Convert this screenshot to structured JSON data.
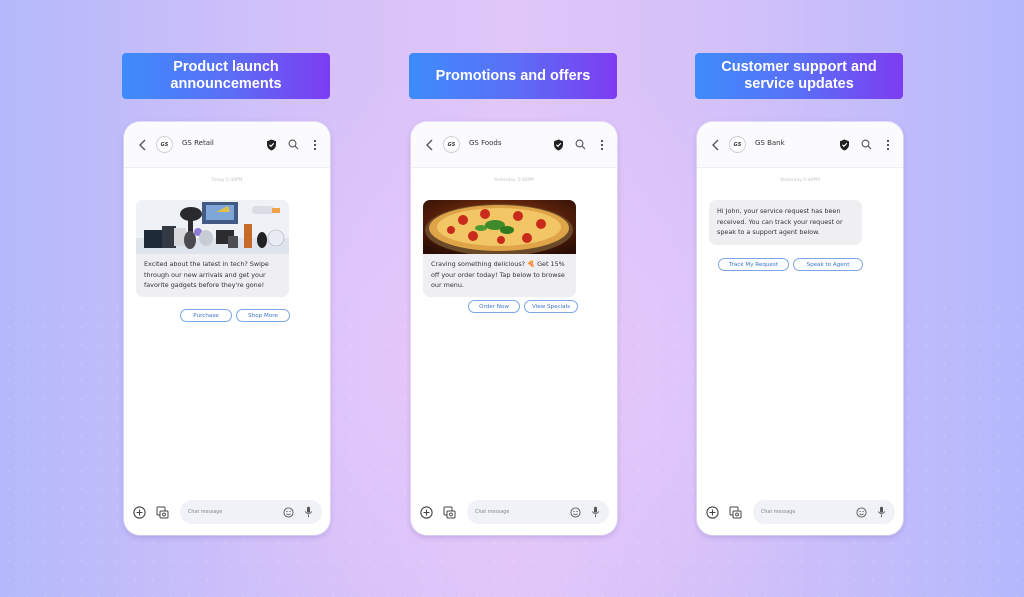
{
  "theme": {
    "accent_chip_border": "#7aa6e8",
    "accent_chip_text": "#3e73c9",
    "badge_gradient": [
      "#3e8cfc",
      "#7d3cf1"
    ]
  },
  "columns": [
    {
      "label": "Product launch announcements",
      "phone": {
        "brand_logo": "GS",
        "brand_name": "GS Retail",
        "timestamp": "Today 5:40PM",
        "image": "tech-gadgets-image",
        "message": "Excited about the latest in tech? Swipe through our new arrivals and get your favorite gadgets before they're gone!",
        "actions": [
          "Purchase",
          "Shop More"
        ],
        "compose_placeholder": "Chat message"
      }
    },
    {
      "label": "Promotions and offers",
      "phone": {
        "brand_logo": "GS",
        "brand_name": "GS Foods",
        "timestamp": "Yesterday 5:40PM",
        "image": "pizza-image",
        "message": "Craving something delicious? 🍕 Get 15% off your order today! Tap below to browse our menu.",
        "actions": [
          "Order Now",
          "View Specials"
        ],
        "compose_placeholder": "Chat message"
      }
    },
    {
      "label": "Customer support and service updates",
      "phone": {
        "brand_logo": "GS",
        "brand_name": "GS Bank",
        "timestamp": "Yesterday 5:40PM",
        "message": "Hi John, your service request has been received. You can track your request or speak to a support agent below.",
        "actions": [
          "Track My Request",
          "Speak to Agent"
        ],
        "compose_placeholder": "Chat message"
      }
    }
  ],
  "icons": {
    "back": "chevron-left",
    "verified": "shield-check",
    "search": "magnifier",
    "more": "vertical-dots",
    "add": "plus-circle",
    "media": "gallery",
    "emoji": "smiley",
    "mic": "microphone"
  }
}
